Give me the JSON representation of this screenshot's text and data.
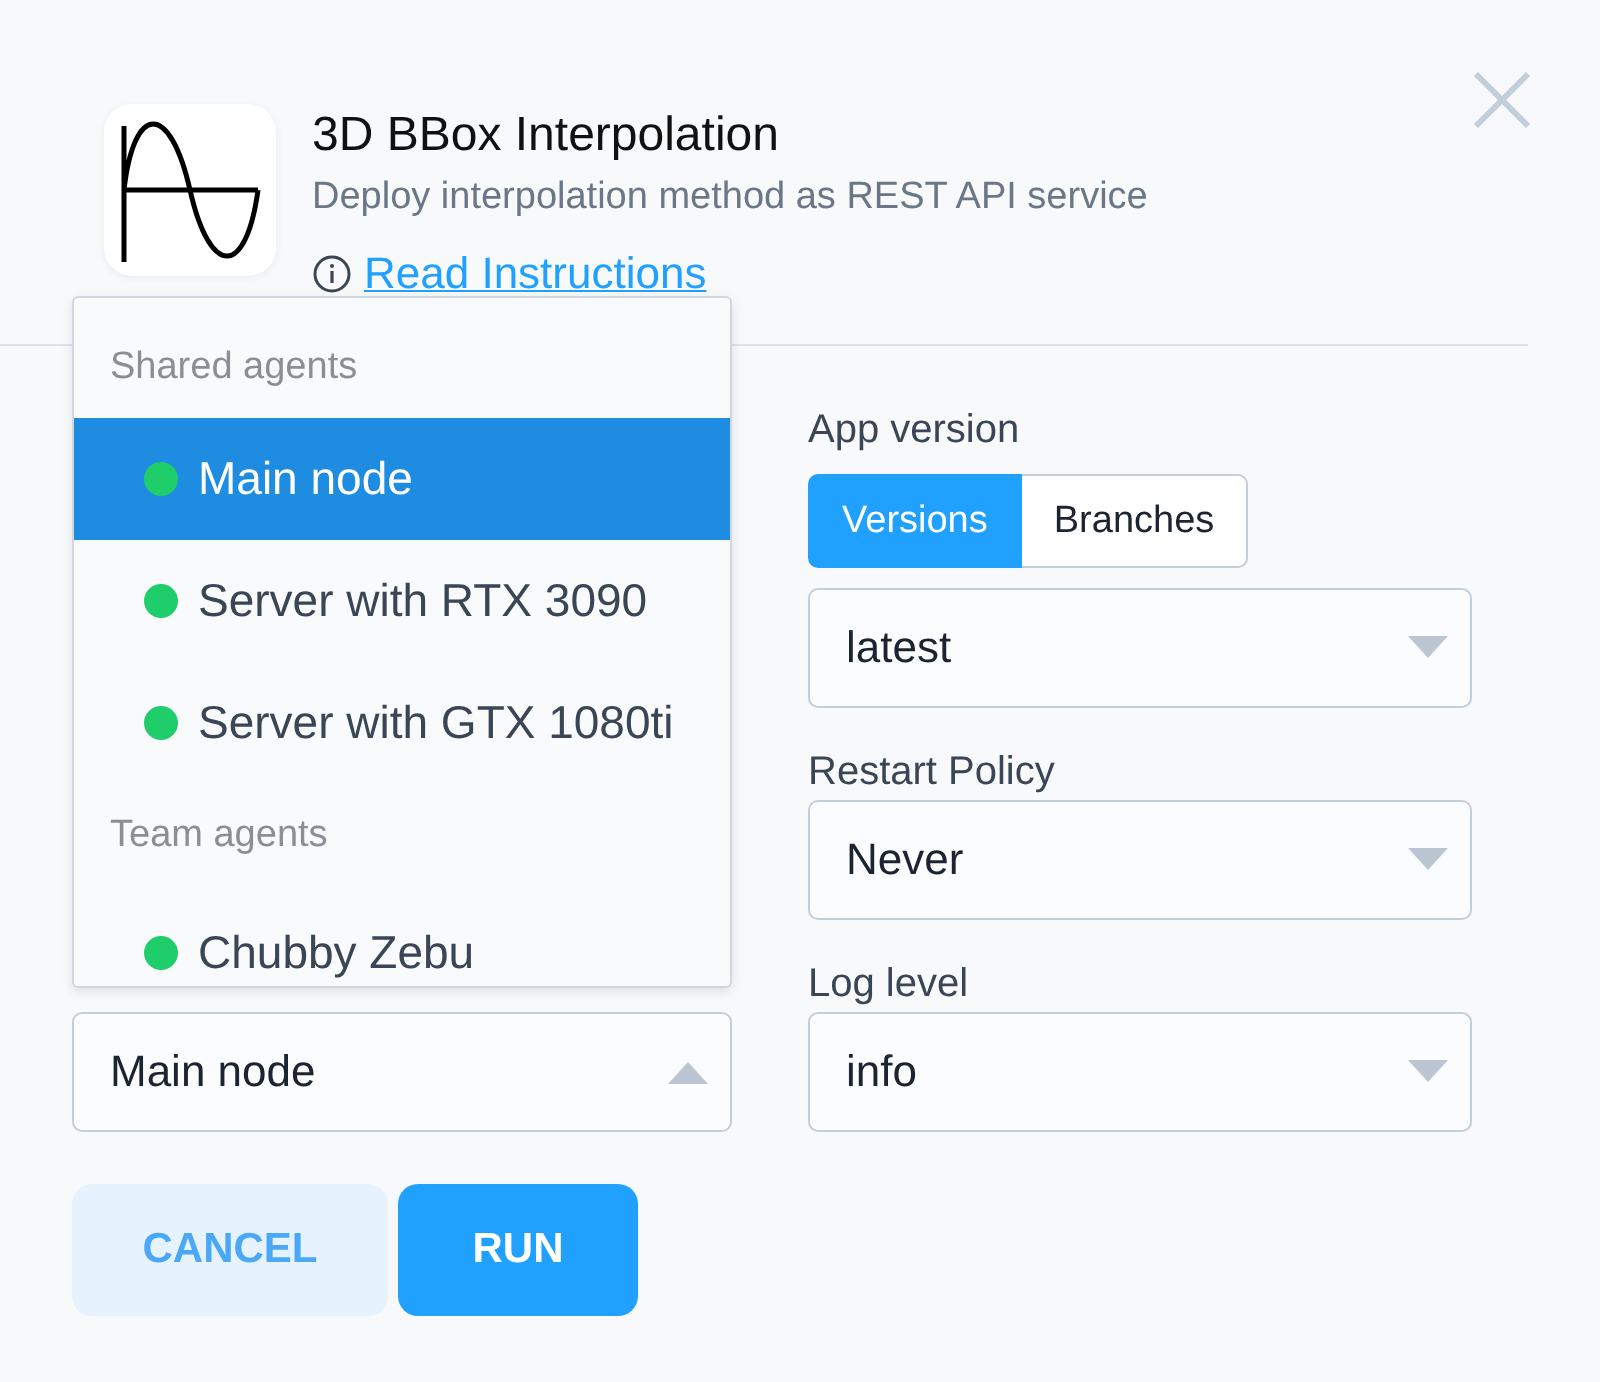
{
  "header": {
    "title": "3D BBox Interpolation",
    "description": "Deploy interpolation method as REST API service",
    "link": "Read Instructions"
  },
  "agent_select": {
    "value": "Main node",
    "expanded": true,
    "groups": [
      {
        "label": "Shared agents",
        "items": [
          {
            "label": "Main node",
            "selected": true
          },
          {
            "label": "Server with RTX 3090",
            "selected": false
          },
          {
            "label": "Server with GTX 1080ti",
            "selected": false
          }
        ]
      },
      {
        "label": "Team agents",
        "items": [
          {
            "label": "Chubby Zebu",
            "selected": false
          }
        ]
      }
    ]
  },
  "fields": [
    {
      "kind": "segmented_select",
      "label": "App version",
      "segments": [
        {
          "label": "Versions",
          "selected": true
        },
        {
          "label": "Branches",
          "selected": false
        }
      ],
      "value": "latest"
    },
    {
      "kind": "select",
      "label": "Restart Policy",
      "value": "Never"
    },
    {
      "kind": "select",
      "label": "Log level",
      "value": "info"
    }
  ],
  "buttons": [
    {
      "kind": "secondary",
      "label": "CANCEL"
    },
    {
      "kind": "primary",
      "label": "RUN"
    }
  ]
}
